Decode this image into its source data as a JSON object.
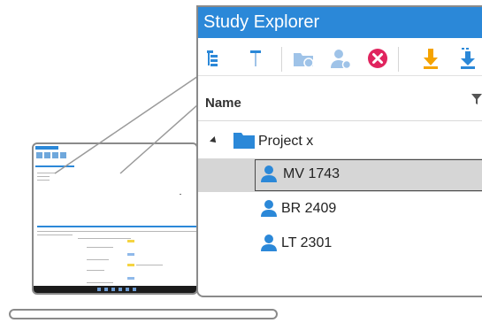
{
  "window": {
    "title": "Study Explorer"
  },
  "toolbar": {
    "icons": [
      "tree-view-icon",
      "filter-pin-icon",
      "new-folder-icon",
      "add-patient-icon",
      "delete-icon",
      "download-icon",
      "download-all-icon"
    ]
  },
  "columns": {
    "name_header": "Name"
  },
  "tree": {
    "project": {
      "label": "Project x"
    },
    "items": [
      {
        "label": "MV 1743",
        "selected": true
      },
      {
        "label": "BR 2409",
        "selected": false
      },
      {
        "label": "LT 2301",
        "selected": false
      }
    ]
  },
  "colors": {
    "accent": "#2b88d8",
    "selection": "#d6d6d6",
    "delete": "#e0245e",
    "download": "#f5a300"
  }
}
